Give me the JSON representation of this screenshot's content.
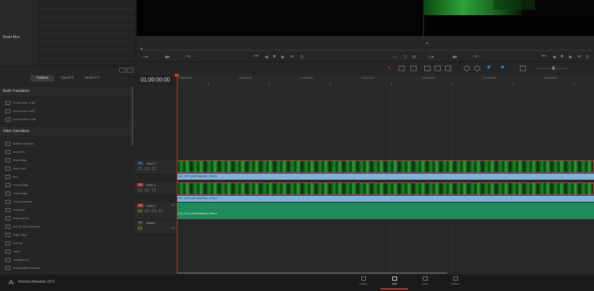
{
  "media_pool": {
    "bin_label": "Smart Bins"
  },
  "viewer": {
    "timecode_label": ""
  },
  "effects": {
    "tabs": [
      "Toolbox",
      "OpenFX",
      "Audio FX"
    ],
    "active_tab": "Toolbox",
    "audio_transitions_header": "Audio Transitions",
    "audio_transitions": [
      "Cross Fade -3 dB",
      "Cross Fade 0 dB",
      "Cross Fade +3 dB"
    ],
    "video_transitions_header": "Video Transitions",
    "video_transitions": [
      "Additive Dissolve",
      "Arrow Iris",
      "Band Wipe",
      "Barn Door",
      "Box",
      "Center Wipe",
      "Clock Wipe",
      "Cross Dissolve",
      "Cross Iris",
      "Diamond Iris",
      "Dip To Color Dissolve",
      "Edge Wipe",
      "Eye Iris",
      "Heart",
      "Hexagon Iris",
      "Non-Additive Dissolve"
    ]
  },
  "timeline": {
    "timecode": "01:00:00:00",
    "ruler_labels": [
      "01:00:00:00",
      "01:00:04:00",
      "01:00:08:00",
      "01:00:12:00",
      "01:00:16:00",
      "01:00:20:00",
      "01:00:24:00"
    ],
    "tracks": {
      "v2": {
        "tag": "V2",
        "name": "Video 2"
      },
      "v1": {
        "tag": "V1",
        "name": "Video 1"
      },
      "a1": {
        "tag": "A1",
        "name": "Audio 1",
        "level": "2.0"
      },
      "m": {
        "tag": "M",
        "name": "Master",
        "level": "2.0"
      }
    },
    "clips": {
      "v2_label": "LED_HDR_MatrixDataRain_Titles.vt",
      "v1_label": "LED_HDR_MatrixDataRain_Titles.vt",
      "a1_label": "LED_HDR_MatrixDataRain_Titles.vt"
    }
  },
  "app": {
    "name": "DaVinci Resolve 12.5"
  },
  "pages": [
    "Media",
    "Edit",
    "Color",
    "Deliver"
  ],
  "active_page": "Edit",
  "colors": {
    "playhead": "#c03a2e",
    "video_clip": "#1c8a2a",
    "audio_clip": "#1f8a5b",
    "clip_label": "#7fb2d8"
  }
}
